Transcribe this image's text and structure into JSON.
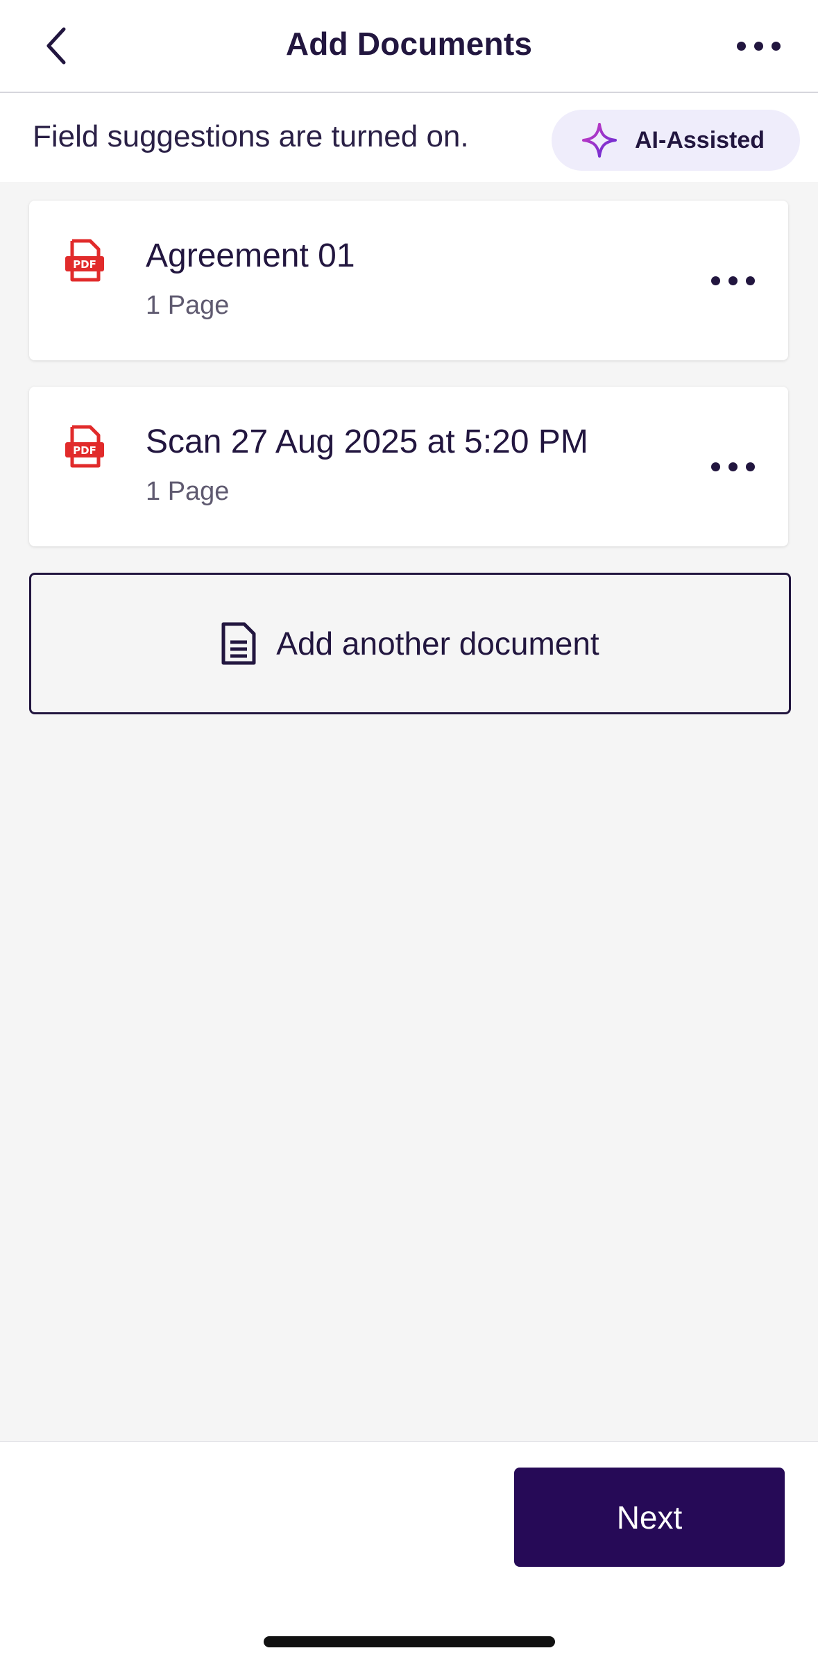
{
  "header": {
    "title": "Add Documents",
    "back_icon": "chevron-left-icon",
    "more_icon": "more-horizontal-icon"
  },
  "suggestions": {
    "text": "Field suggestions are turned on.",
    "badge_label": "AI-Assisted",
    "badge_icon": "sparkle-icon"
  },
  "documents": [
    {
      "name": "Agreement 01",
      "pages": "1 Page",
      "icon": "pdf-icon"
    },
    {
      "name": "Scan 27 Aug 2025 at 5:20 PM",
      "pages": "1 Page",
      "icon": "pdf-icon"
    }
  ],
  "add_document": {
    "label": "Add another document",
    "icon": "document-icon"
  },
  "footer": {
    "next_label": "Next"
  },
  "colors": {
    "brand_primary": "#260a57",
    "text_dark": "#22163f",
    "pdf_red": "#e12b2b",
    "ai_badge_bg": "#efedfb"
  }
}
